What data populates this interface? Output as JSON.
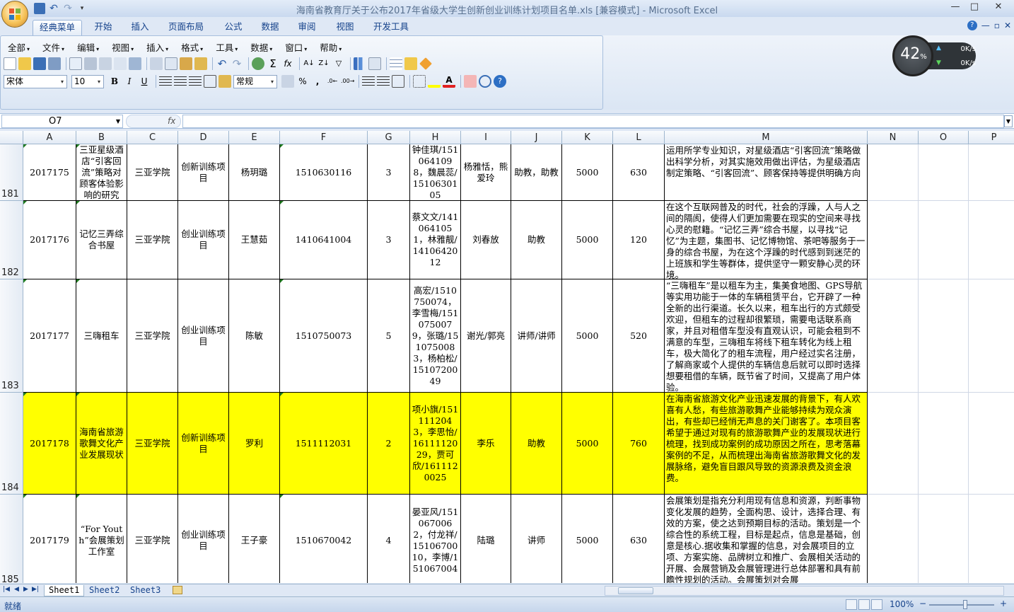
{
  "window": {
    "title": "海南省教育厅关于公布2017年省级大学生创新创业训练计划项目名单.xls  [兼容模式] - Microsoft Excel",
    "controls": [
      "—",
      "□",
      "✕"
    ]
  },
  "ribbon_tabs": [
    "经典菜单",
    "开始",
    "插入",
    "页面布局",
    "公式",
    "数据",
    "审阅",
    "视图",
    "开发工具"
  ],
  "active_tab": "经典菜单",
  "classic_menu": [
    "全部",
    "文件",
    "编辑",
    "视图",
    "插入",
    "格式",
    "工具",
    "数据",
    "窗口",
    "帮助"
  ],
  "font_name": "宋体",
  "font_size": "10",
  "number_format": "常规",
  "percent_symbol": "%",
  "comma_symbol": ",",
  "net_widget": {
    "percent": "42",
    "percent_sign": "%",
    "up": "0K/s",
    "down": "0K/s"
  },
  "name_box": "O7",
  "fx_label": "fx",
  "formula": "",
  "columns": [
    "A",
    "B",
    "C",
    "D",
    "E",
    "F",
    "G",
    "H",
    "I",
    "J",
    "K",
    "L",
    "M",
    "N",
    "O",
    "P"
  ],
  "rows": [
    {
      "num": "181",
      "highlight": false,
      "a": "2017175",
      "b": "三亚星级酒店“引客回流”策略对顾客体验影响的研究",
      "c": "三亚学院",
      "d": "创新训练项目",
      "e": "杨玥璐",
      "f": "1510630116",
      "g": "3",
      "h": "钟佳琪/1510641098，魏晨蕊/1510630105",
      "i": "杨雅恬，熊爱玲",
      "j": "助教，助教",
      "k": "5000",
      "l": "630",
      "m": "运用所学专业知识，对星级酒店“引客回流”策略做出科学分析，对其实施效用做出评估，为星级酒店制定策略、“引客回流”、顾客保持等提供明确方向"
    },
    {
      "num": "182",
      "highlight": false,
      "a": "2017176",
      "b": "记忆三弄综合书屋",
      "c": "三亚学院",
      "d": "创业训练项目",
      "e": "王慧茹",
      "f": "1410641004",
      "g": "3",
      "h": "蔡文文/1410641051，林雅靓/1410642012",
      "i": "刘春放",
      "j": "助教",
      "k": "5000",
      "l": "120",
      "m": "在这个互联网普及的时代，社会的浮躁，人与人之间的隔阂，使得人们更加需要在现实的空间来寻找心灵的慰籍。“记忆三弄”综合书屋，以寻找“记忆”为主题，集图书、记忆博物馆、茶吧等服务于一身的综合书屋，为在这个浮躁的时代感到到迷茫的上班族和学生等群体，提供坚守一颗安静心灵的环境。"
    },
    {
      "num": "183",
      "highlight": false,
      "a": "2017177",
      "b": "三嗨租车",
      "c": "三亚学院",
      "d": "创业训练项目",
      "e": "陈敏",
      "f": "1510750073",
      "g": "5",
      "h": "高宏/1510750074，李雪梅/1510750079，张璐/1510750083，杨柏松/1510720049",
      "i": "谢光/郭亮",
      "j": "讲师/讲师",
      "k": "5000",
      "l": "520",
      "m": "“三嗨租车”是以租车为主，集美食地图、GPS导航等实用功能于一体的车辆租赁平台，它开辟了一种全新的出行渠道。长久以来，租车出行的方式颇受欢迎，但租车的过程却很繁琐，需要电话联系商家，并且对租借车型没有直观认识，可能会租到不满意的车型，三嗨租车将线下租车转化为线上租车，极大简化了的租车流程，用户经过实名注册，了解商家或个人提供的车辆信息后就可以即时选择想要租借的车辆，既节省了时间，又提高了用户体验。"
    },
    {
      "num": "184",
      "highlight": true,
      "a": "2017178",
      "b": "海南省旅游歌舞文化产业发展现状",
      "c": "三亚学院",
      "d": "创新训练项目",
      "e": "罗利",
      "f": "1511112031",
      "g": "2",
      "h": "项小旗/1511112043，李思怡/1611112029，贾可欣/1611120025",
      "i": "李乐",
      "j": "助教",
      "k": "5000",
      "l": "760",
      "m": "在海南省旅游文化产业迅速发展的背景下，有人欢喜有人愁，有些旅游歌舞产业能够持续为观众演出，有些却已经悄无声息的关门谢客了。本项目客希望于通过对现有的旅游歌舞产业的发展现状进行梳理，找到成功案例的成功原因之所在，思考落幕案例的不足，从而梳理出海南省旅游歌舞文化的发展脉络，避免盲目跟风导致的资源浪费及资金浪费。"
    },
    {
      "num": "185",
      "highlight": false,
      "a": "2017179",
      "b": "“For Youth”会展策划工作室",
      "c": "三亚学院",
      "d": "创业训练项目",
      "e": "王子豪",
      "f": "1510670042",
      "g": "4",
      "h": "晏亚风/1510670062，付龙祥/1510670010，李博/151067004",
      "i": "陆璐",
      "j": "讲师",
      "k": "5000",
      "l": "630",
      "m": "会展策划是指充分利用现有信息和资源，判断事物变化发展的趋势，全面构思、设计，选择合理、有效的方案，使之达到预期目标的活动。策划是一个综合性的系统工程，目标是起点，信息是基础，创意是核心.据收集和掌握的信息，对会展项目的立项、方案实施、品牌树立和推广、会展相关活动的开展、会展营销及会展管理进行总体部署和具有前瞻性规划的活动。会展策划对会展"
    }
  ],
  "sheets": [
    "Sheet1",
    "Sheet2",
    "Sheet3"
  ],
  "active_sheet": "Sheet1",
  "status": "就绪",
  "zoom": "100%",
  "colors": {
    "highlight": "#ffff00",
    "ribbon": "#dfe8f5",
    "accent": "#15428b"
  }
}
